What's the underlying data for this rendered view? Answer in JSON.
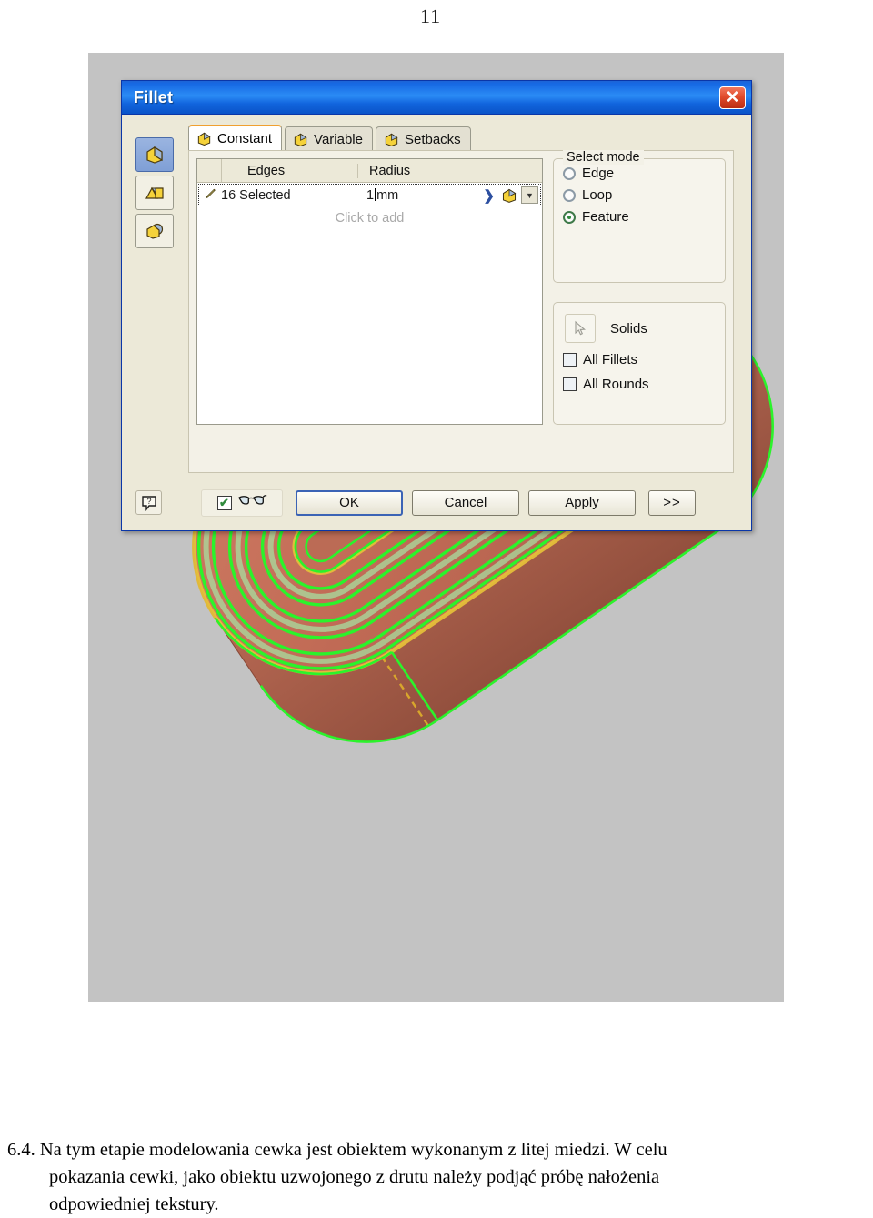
{
  "page": {
    "number": "11"
  },
  "viewport": {
    "background_color": "#c3c3c3",
    "model_name": "coil-3d-model",
    "body_color": "#c4705c",
    "highlight_edge_color": "#2bf32b",
    "secondary_edge_color": "#e8c13a"
  },
  "dialog": {
    "title": "Fillet",
    "close_label": "✕",
    "side_toolbar": [
      {
        "name": "edge-fillet-tool",
        "selected": true
      },
      {
        "name": "face-fillet-tool",
        "selected": false
      },
      {
        "name": "full-round-fillet-tool",
        "selected": false
      }
    ],
    "tabs": [
      {
        "label": "Constant",
        "active": true
      },
      {
        "label": "Variable",
        "active": false
      },
      {
        "label": "Setbacks",
        "active": false
      }
    ],
    "table": {
      "headers": {
        "edges": "Edges",
        "radius": "Radius"
      },
      "rows": [
        {
          "edges": "16 Selected",
          "radius_value": "1",
          "radius_unit": "mm"
        }
      ],
      "add_hint": "Click to add",
      "row_chevron": "❯",
      "row_dropdown": "▼"
    },
    "select_mode": {
      "legend": "Select mode",
      "options": [
        {
          "label": "Edge",
          "selected": false
        },
        {
          "label": "Loop",
          "selected": false
        },
        {
          "label": "Feature",
          "selected": true
        }
      ]
    },
    "solids": {
      "button_label": "Solids",
      "checkboxes": [
        {
          "label": "All Fillets",
          "checked": false
        },
        {
          "label": "All Rounds",
          "checked": false
        }
      ]
    },
    "footer": {
      "help_label": "?",
      "preview_checked": "✔",
      "preview_icon_name": "glasses-icon",
      "ok": "OK",
      "cancel": "Cancel",
      "apply": "Apply",
      "more": ">>"
    }
  },
  "body_text": {
    "item_number": "6.4.",
    "line1": "Na tym etapie modelowania cewka jest obiektem wykonanym z litej miedzi. W celu",
    "line2": "pokazania cewki, jako obiektu uzwojonego z drutu należy podjąć próbę nałożenia",
    "line3": "odpowiedniej tekstury."
  }
}
